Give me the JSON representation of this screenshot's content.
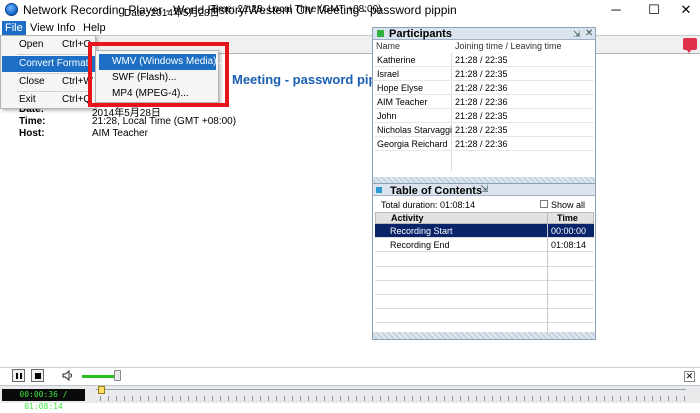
{
  "window": {
    "title": "Network Recording Player - World History/Western Civ  Meeting - password pippin",
    "minimize_glyph": "─",
    "maximize_glyph": "☐",
    "close_glyph": "✕"
  },
  "menubar": {
    "items": [
      {
        "label": "File"
      },
      {
        "label": "View"
      },
      {
        "label": "Info"
      },
      {
        "label": "Help"
      }
    ]
  },
  "file_menu": {
    "items": [
      {
        "label": "Open",
        "shortcut": "Ctrl+O"
      },
      {
        "label": "Convert Format",
        "shortcut": ""
      },
      {
        "label": "Close",
        "shortcut": "Ctrl+W"
      },
      {
        "label": "Exit",
        "shortcut": "Ctrl+Q"
      }
    ]
  },
  "convert_submenu": {
    "items": [
      {
        "label": "WMV (Windows Media)..."
      },
      {
        "label": "SWF (Flash)..."
      },
      {
        "label": "MP4 (MPEG-4)..."
      }
    ]
  },
  "header_bar": {
    "date_text": "Date: 2014年5月28日",
    "time_text": "Time: 21:28, Local Time (GMT +08:00)"
  },
  "meeting": {
    "title": "Meeting - password pippin",
    "date_label": "Date:",
    "date_value": "2014年5月28日",
    "time_label": "Time:",
    "time_value": "21:28, Local Time (GMT +08:00)",
    "host_label": "Host:",
    "host_value": "AIM Teacher"
  },
  "participants": {
    "title": "Participants",
    "pin_glyph": "⇲",
    "close_glyph": "✕",
    "col_name": "Name",
    "col_time": "Joining time / Leaving time",
    "rows": [
      {
        "name": "Katherine",
        "time": "21:28 / 22:35"
      },
      {
        "name": "Israel",
        "time": "21:28 / 22:35"
      },
      {
        "name": "Hope Elyse",
        "time": "21:28 / 22:36"
      },
      {
        "name": "AIM Teacher",
        "time": "21:28 / 22:36"
      },
      {
        "name": "John",
        "time": "21:28 / 22:35"
      },
      {
        "name": "Nicholas Starvaggi",
        "time": "21:28 / 22:35"
      },
      {
        "name": "Georgia Reichard",
        "time": "21:28 / 22:36"
      }
    ]
  },
  "toc": {
    "title": "Table of Contents",
    "pin_glyph": "⇲",
    "total_duration": "Total duration: 01:08:14",
    "show_all": "Show all",
    "col_activity": "Activity",
    "col_time": "Time",
    "rows": [
      {
        "activity": "Recording Start",
        "time": "00:00:00"
      },
      {
        "activity": "Recording End",
        "time": "01:08:14"
      }
    ]
  },
  "player": {
    "time_readout": "00:00:36 / 01:08:14",
    "close_glyph": "✕",
    "volume_level": 0.85,
    "position_fraction": 0.009
  },
  "colors": {
    "accent": "#1c6fc5",
    "highlight_box": "#e8141c",
    "meeting_title": "#1b5fb5",
    "toc_selection": "#0a246a",
    "time_readout_text": "#3fe83f"
  }
}
